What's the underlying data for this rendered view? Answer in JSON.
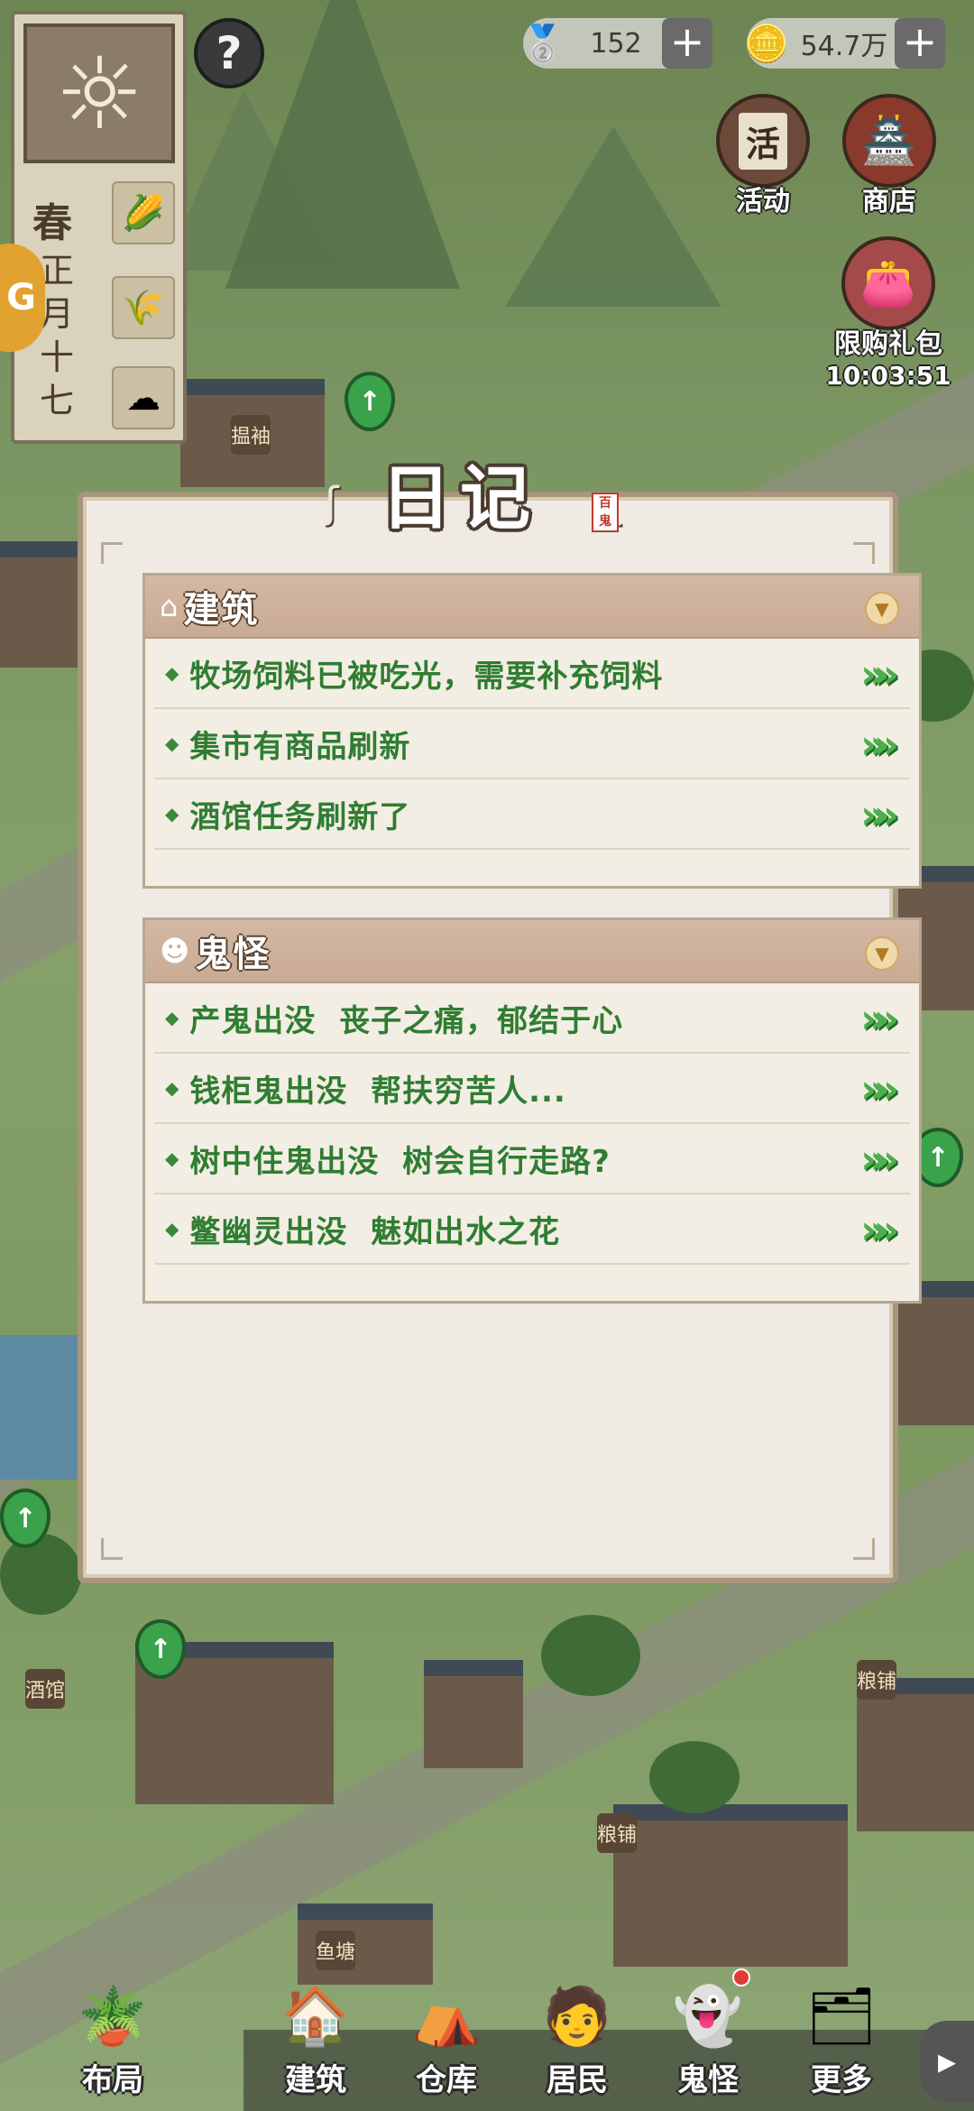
{
  "hud": {
    "season": "春",
    "date": "正月十七",
    "help": "?",
    "side_tab": "G",
    "silver": "152",
    "coins": "54.7万",
    "plus": "+",
    "activity_label": "活动",
    "activity_glyph": "活",
    "shop_label": "商店",
    "giftpack_label": "限购礼包",
    "giftpack_timer": "10:03:51"
  },
  "map": {
    "signs": [
      "揾袖",
      "酒馆",
      "粮铺",
      "粮铺",
      "鱼塘"
    ]
  },
  "diary": {
    "title": "日记",
    "stamp": "百鬼",
    "sections": [
      {
        "title": "建筑",
        "icon": "house-icon",
        "items": [
          {
            "text": "牧场饲料已被吃光，需要补充饲料"
          },
          {
            "text": "集市有商品刷新"
          },
          {
            "text": "酒馆任务刷新了"
          }
        ]
      },
      {
        "title": "鬼怪",
        "icon": "ghost-icon",
        "items": [
          {
            "text": "产鬼出没  丧子之痛，郁结于心"
          },
          {
            "text": "钱柜鬼出没  帮扶穷苦人..."
          },
          {
            "text": "树中住鬼出没  树会自行走路?"
          },
          {
            "text": "鳖幽灵出没  魅如出水之花"
          }
        ]
      }
    ]
  },
  "nav": {
    "items": [
      {
        "label": "布局",
        "icon": "layout-icon"
      },
      {
        "label": "建筑",
        "icon": "building-icon"
      },
      {
        "label": "仓库",
        "icon": "warehouse-icon"
      },
      {
        "label": "居民",
        "icon": "resident-icon"
      },
      {
        "label": "鬼怪",
        "icon": "ghost-icon"
      },
      {
        "label": "更多",
        "icon": "more-icon"
      }
    ]
  },
  "colors": {
    "item_text": "#2f7d32",
    "section_header": "#c9ab95",
    "dialog_bg": "#efebe4"
  }
}
